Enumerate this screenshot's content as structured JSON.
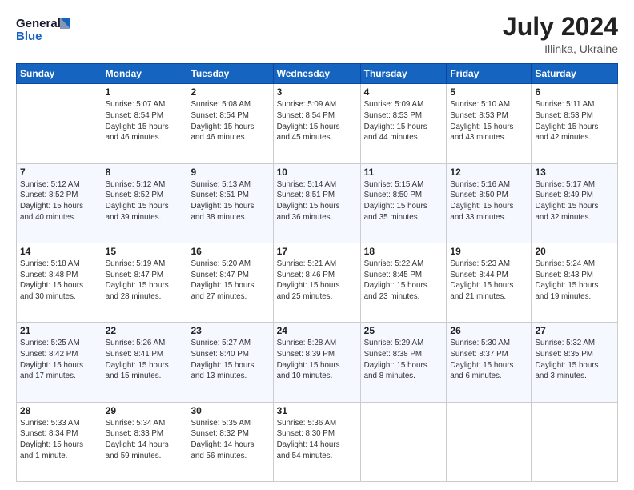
{
  "header": {
    "logo_line1": "General",
    "logo_line2": "Blue",
    "month_year": "July 2024",
    "location": "Illinka, Ukraine"
  },
  "weekdays": [
    "Sunday",
    "Monday",
    "Tuesday",
    "Wednesday",
    "Thursday",
    "Friday",
    "Saturday"
  ],
  "weeks": [
    [
      {
        "day": "",
        "info": ""
      },
      {
        "day": "1",
        "info": "Sunrise: 5:07 AM\nSunset: 8:54 PM\nDaylight: 15 hours\nand 46 minutes."
      },
      {
        "day": "2",
        "info": "Sunrise: 5:08 AM\nSunset: 8:54 PM\nDaylight: 15 hours\nand 46 minutes."
      },
      {
        "day": "3",
        "info": "Sunrise: 5:09 AM\nSunset: 8:54 PM\nDaylight: 15 hours\nand 45 minutes."
      },
      {
        "day": "4",
        "info": "Sunrise: 5:09 AM\nSunset: 8:53 PM\nDaylight: 15 hours\nand 44 minutes."
      },
      {
        "day": "5",
        "info": "Sunrise: 5:10 AM\nSunset: 8:53 PM\nDaylight: 15 hours\nand 43 minutes."
      },
      {
        "day": "6",
        "info": "Sunrise: 5:11 AM\nSunset: 8:53 PM\nDaylight: 15 hours\nand 42 minutes."
      }
    ],
    [
      {
        "day": "7",
        "info": "Sunrise: 5:12 AM\nSunset: 8:52 PM\nDaylight: 15 hours\nand 40 minutes."
      },
      {
        "day": "8",
        "info": "Sunrise: 5:12 AM\nSunset: 8:52 PM\nDaylight: 15 hours\nand 39 minutes."
      },
      {
        "day": "9",
        "info": "Sunrise: 5:13 AM\nSunset: 8:51 PM\nDaylight: 15 hours\nand 38 minutes."
      },
      {
        "day": "10",
        "info": "Sunrise: 5:14 AM\nSunset: 8:51 PM\nDaylight: 15 hours\nand 36 minutes."
      },
      {
        "day": "11",
        "info": "Sunrise: 5:15 AM\nSunset: 8:50 PM\nDaylight: 15 hours\nand 35 minutes."
      },
      {
        "day": "12",
        "info": "Sunrise: 5:16 AM\nSunset: 8:50 PM\nDaylight: 15 hours\nand 33 minutes."
      },
      {
        "day": "13",
        "info": "Sunrise: 5:17 AM\nSunset: 8:49 PM\nDaylight: 15 hours\nand 32 minutes."
      }
    ],
    [
      {
        "day": "14",
        "info": "Sunrise: 5:18 AM\nSunset: 8:48 PM\nDaylight: 15 hours\nand 30 minutes."
      },
      {
        "day": "15",
        "info": "Sunrise: 5:19 AM\nSunset: 8:47 PM\nDaylight: 15 hours\nand 28 minutes."
      },
      {
        "day": "16",
        "info": "Sunrise: 5:20 AM\nSunset: 8:47 PM\nDaylight: 15 hours\nand 27 minutes."
      },
      {
        "day": "17",
        "info": "Sunrise: 5:21 AM\nSunset: 8:46 PM\nDaylight: 15 hours\nand 25 minutes."
      },
      {
        "day": "18",
        "info": "Sunrise: 5:22 AM\nSunset: 8:45 PM\nDaylight: 15 hours\nand 23 minutes."
      },
      {
        "day": "19",
        "info": "Sunrise: 5:23 AM\nSunset: 8:44 PM\nDaylight: 15 hours\nand 21 minutes."
      },
      {
        "day": "20",
        "info": "Sunrise: 5:24 AM\nSunset: 8:43 PM\nDaylight: 15 hours\nand 19 minutes."
      }
    ],
    [
      {
        "day": "21",
        "info": "Sunrise: 5:25 AM\nSunset: 8:42 PM\nDaylight: 15 hours\nand 17 minutes."
      },
      {
        "day": "22",
        "info": "Sunrise: 5:26 AM\nSunset: 8:41 PM\nDaylight: 15 hours\nand 15 minutes."
      },
      {
        "day": "23",
        "info": "Sunrise: 5:27 AM\nSunset: 8:40 PM\nDaylight: 15 hours\nand 13 minutes."
      },
      {
        "day": "24",
        "info": "Sunrise: 5:28 AM\nSunset: 8:39 PM\nDaylight: 15 hours\nand 10 minutes."
      },
      {
        "day": "25",
        "info": "Sunrise: 5:29 AM\nSunset: 8:38 PM\nDaylight: 15 hours\nand 8 minutes."
      },
      {
        "day": "26",
        "info": "Sunrise: 5:30 AM\nSunset: 8:37 PM\nDaylight: 15 hours\nand 6 minutes."
      },
      {
        "day": "27",
        "info": "Sunrise: 5:32 AM\nSunset: 8:35 PM\nDaylight: 15 hours\nand 3 minutes."
      }
    ],
    [
      {
        "day": "28",
        "info": "Sunrise: 5:33 AM\nSunset: 8:34 PM\nDaylight: 15 hours\nand 1 minute."
      },
      {
        "day": "29",
        "info": "Sunrise: 5:34 AM\nSunset: 8:33 PM\nDaylight: 14 hours\nand 59 minutes."
      },
      {
        "day": "30",
        "info": "Sunrise: 5:35 AM\nSunset: 8:32 PM\nDaylight: 14 hours\nand 56 minutes."
      },
      {
        "day": "31",
        "info": "Sunrise: 5:36 AM\nSunset: 8:30 PM\nDaylight: 14 hours\nand 54 minutes."
      },
      {
        "day": "",
        "info": ""
      },
      {
        "day": "",
        "info": ""
      },
      {
        "day": "",
        "info": ""
      }
    ]
  ]
}
